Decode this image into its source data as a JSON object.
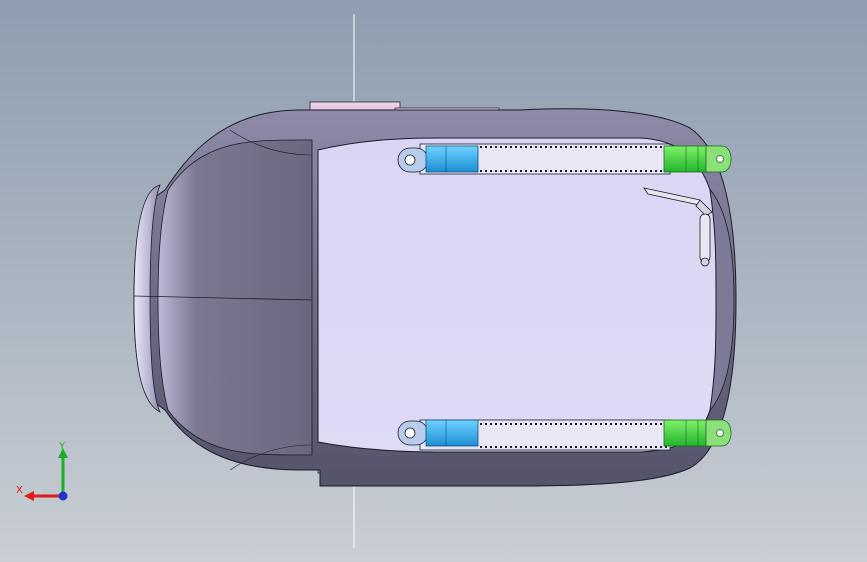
{
  "scene": {
    "model": "seat-assembly",
    "view": "top"
  },
  "triad": {
    "x_label": "X",
    "y_label": "Y",
    "colors": {
      "x": "#e01a1a",
      "y": "#1faa2a",
      "z": "#2a3bd8",
      "origin": "#2035c8"
    }
  },
  "colors": {
    "background_top": "#8e9db0",
    "background_bottom": "#c9ced4",
    "seat_cushion": "#dcd9f5",
    "seat_shell": "#6f6c8a",
    "backrest": "#6d6a82",
    "bracket": "#d8b7d6",
    "slider_block": "#2aa6e6",
    "rail_end": "#39c83a",
    "outline": "#1c1c28"
  }
}
